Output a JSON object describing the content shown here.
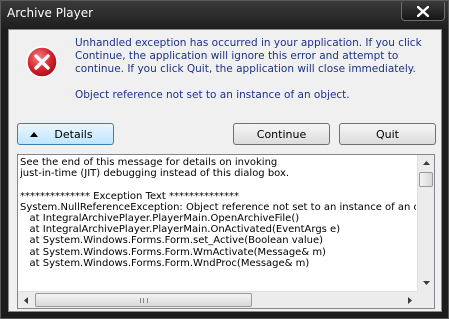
{
  "window": {
    "title": "Archive Player"
  },
  "dialog": {
    "message_main": "Unhandled exception has occurred in your application. If you click Continue, the application will ignore this error and attempt to continue. If you click Quit, the application will close immediately.",
    "message_detail": "Object reference not set to an instance of an object."
  },
  "buttons": {
    "details": "Details",
    "continue": "Continue",
    "quit": "Quit"
  },
  "details_text": "See the end of this message for details on invoking\njust-in-time (JIT) debugging instead of this dialog box.\n\n************** Exception Text **************\nSystem.NullReferenceException: Object reference not set to an instance of an objec\n   at IntegralArchivePlayer.PlayerMain.OpenArchiveFile()\n   at IntegralArchivePlayer.PlayerMain.OnActivated(EventArgs e)\n   at System.Windows.Forms.Form.set_Active(Boolean value)\n   at System.Windows.Forms.Form.WmActivate(Message& m)\n   at System.Windows.Forms.Form.WndProc(Message& m)",
  "icons": {
    "error": "error-icon",
    "close": "close-icon"
  },
  "colors": {
    "message_text": "#1e3287",
    "error_red": "#c8102e"
  }
}
